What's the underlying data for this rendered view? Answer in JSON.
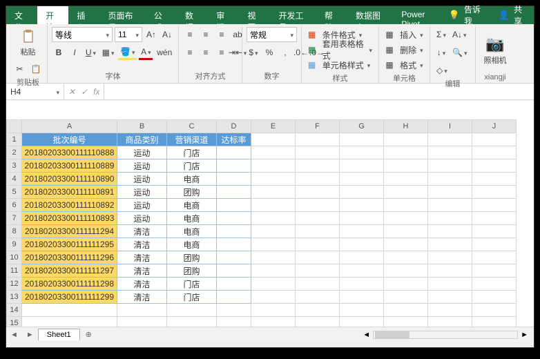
{
  "tabs": {
    "file": "文件",
    "home": "开始",
    "insert": "插入",
    "layout": "页面布局",
    "formula": "公式",
    "data": "数据",
    "review": "审阅",
    "view": "视图",
    "dev": "开发工具",
    "help": "帮助",
    "chart": "数据图表",
    "pivot": "Power Pivot",
    "tellme": "告诉我",
    "share": "共享"
  },
  "ribbon": {
    "clipboard": "剪贴板",
    "font_group": "字体",
    "font_name": "等线",
    "font_size": "11",
    "align_group": "对齐方式",
    "number_group": "数字",
    "number_format": "常规",
    "style_group": "样式",
    "cond_fmt": "条件格式",
    "table_fmt": "套用表格格式",
    "cell_style": "单元格样式",
    "cells_group": "单元格",
    "insert": "插入",
    "delete": "删除",
    "format": "格式",
    "edit_group": "编辑",
    "camera_group": "xiangji",
    "camera": "照相机",
    "wrap": "ab",
    "ruby": "wén"
  },
  "namebox": "H4",
  "columns": [
    "A",
    "B",
    "C",
    "D",
    "E",
    "F",
    "G",
    "H",
    "I",
    "J"
  ],
  "headers": {
    "a": "批次编号",
    "b": "商品类别",
    "c": "营销渠道",
    "d": "达标率"
  },
  "rows": [
    {
      "n": 2,
      "a": "20180203300111110888",
      "b": "运动",
      "c": "门店"
    },
    {
      "n": 3,
      "a": "20180203300111110889",
      "b": "运动",
      "c": "门店"
    },
    {
      "n": 4,
      "a": "20180203300111110890",
      "b": "运动",
      "c": "电商"
    },
    {
      "n": 5,
      "a": "20180203300111110891",
      "b": "运动",
      "c": "团购"
    },
    {
      "n": 6,
      "a": "20180203300111110892",
      "b": "运动",
      "c": "电商"
    },
    {
      "n": 7,
      "a": "20180203300111110893",
      "b": "运动",
      "c": "电商"
    },
    {
      "n": 8,
      "a": "20180203300111111294",
      "b": "清洁",
      "c": "电商"
    },
    {
      "n": 9,
      "a": "20180203300111111295",
      "b": "清洁",
      "c": "电商"
    },
    {
      "n": 10,
      "a": "20180203300111111296",
      "b": "清洁",
      "c": "团购"
    },
    {
      "n": 11,
      "a": "20180203300111111297",
      "b": "清洁",
      "c": "团购"
    },
    {
      "n": 12,
      "a": "20180203300111111298",
      "b": "清洁",
      "c": "门店"
    },
    {
      "n": 13,
      "a": "20180203300111111299",
      "b": "清洁",
      "c": "门店"
    }
  ],
  "empty_rows": [
    14,
    15
  ],
  "sheet1": "Sheet1"
}
